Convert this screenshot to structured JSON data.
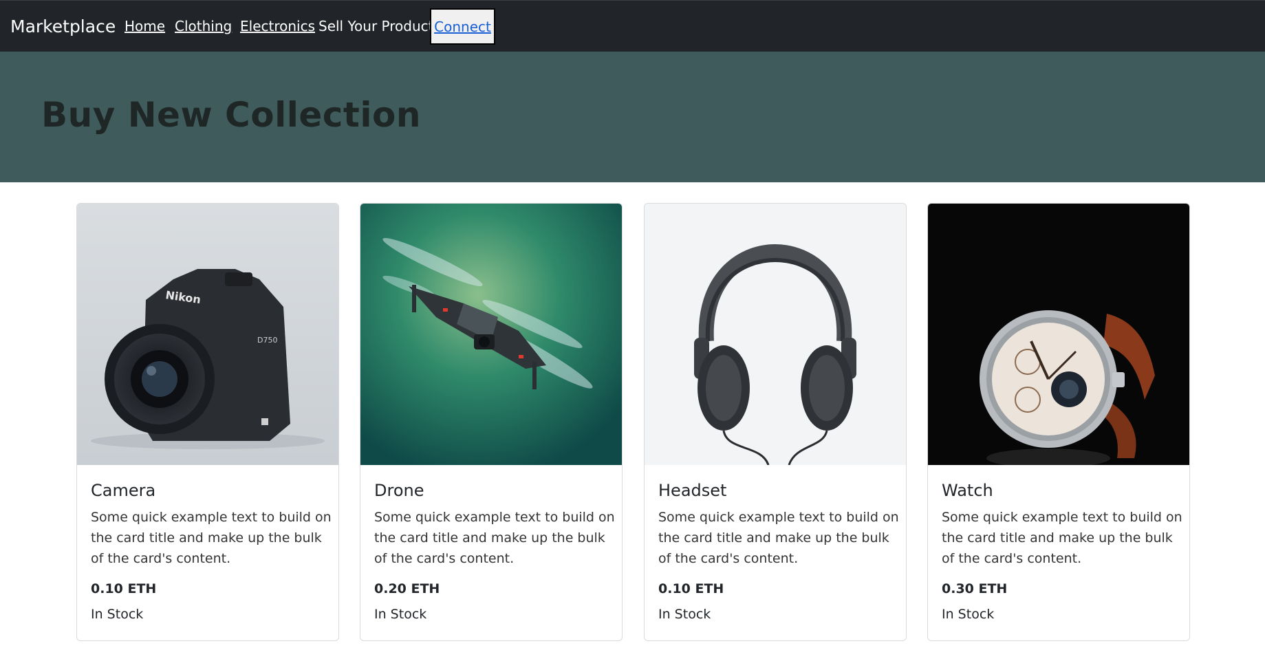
{
  "nav": {
    "brand": "Marketplace",
    "links": [
      "Home",
      "Clothing",
      "Electronics"
    ],
    "sell": "Sell Your Product",
    "connect": "Connect"
  },
  "hero": {
    "title": "Buy New Collection"
  },
  "products": [
    {
      "title": "Camera",
      "text": "Some quick example text to build on the card title and make up the bulk of the card's content.",
      "price": "0.10 ETH",
      "stock": "In Stock",
      "image": "camera-image"
    },
    {
      "title": "Drone",
      "text": "Some quick example text to build on the card title and make up the bulk of the card's content.",
      "price": "0.20 ETH",
      "stock": "In Stock",
      "image": "drone-image"
    },
    {
      "title": "Headset",
      "text": "Some quick example text to build on the card title and make up the bulk of the card's content.",
      "price": "0.10 ETH",
      "stock": "In Stock",
      "image": "headset-image"
    },
    {
      "title": "Watch",
      "text": "Some quick example text to build on the card title and make up the bulk of the card's content.",
      "price": "0.30 ETH",
      "stock": "In Stock",
      "image": "watch-image"
    }
  ],
  "colors": {
    "navbar": "#212529",
    "hero": "#3f5b5b",
    "connect_link": "#1a5fd6"
  }
}
